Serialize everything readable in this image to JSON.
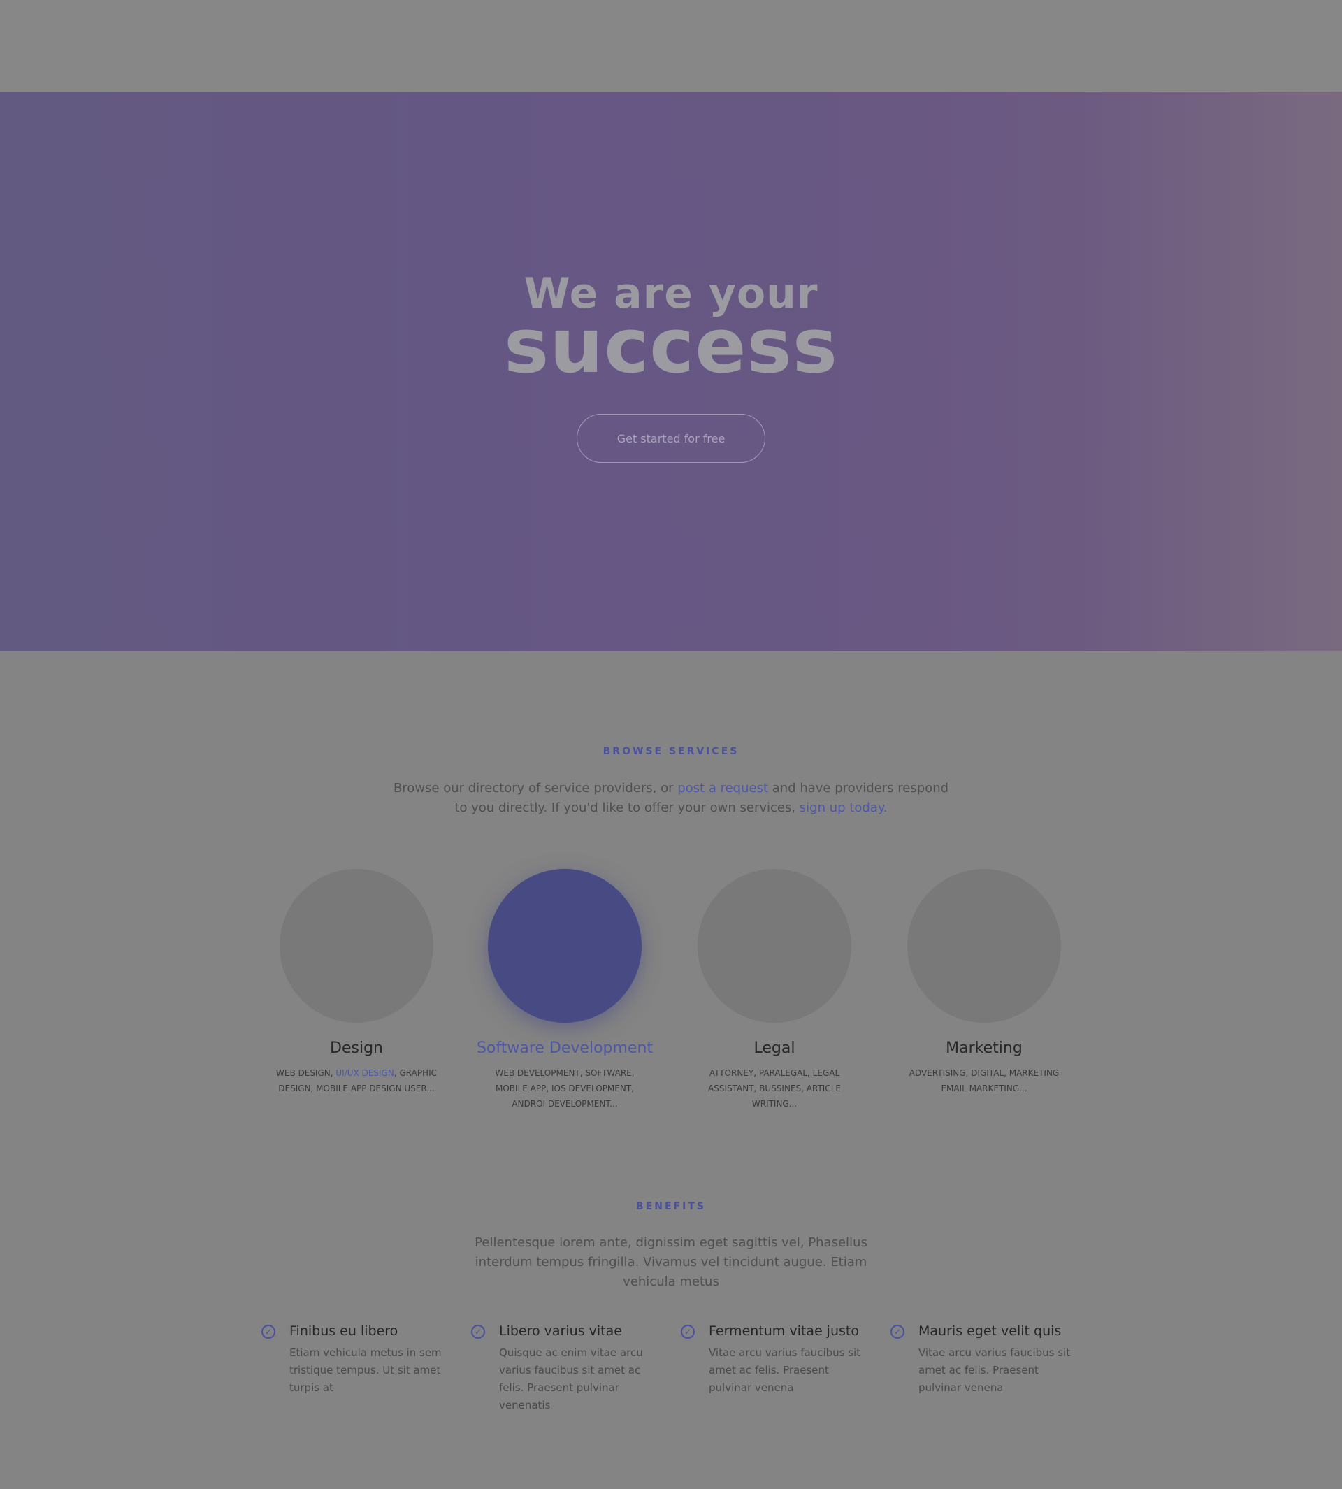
{
  "hero": {
    "line1": "We are your",
    "line2": "success",
    "cta_label": "Get started for free"
  },
  "browse": {
    "eyebrow": "BROWSE SERVICES",
    "text_before": "Browse our directory of service providers, or ",
    "link1": "post a request",
    "text_middle": " and have providers respond to you directly. If you'd like to offer your own services, ",
    "link2": "sign up today",
    "text_after": "."
  },
  "services": [
    {
      "title": "Design",
      "desc_before": "Web design, ",
      "desc_link": "UI/UX design",
      "desc_after": ", graphic design, mobile app design user..."
    },
    {
      "title": "Software Development",
      "desc": "Web development, software, mobile app, IOS development, androi development..."
    },
    {
      "title": "Legal",
      "desc": "Attorney, paralegal, legal assistant, bussines, article writing..."
    },
    {
      "title": "Marketing",
      "desc": "Advertising, digital, marketing email marketing..."
    }
  ],
  "benefits": {
    "eyebrow": "BENEFITS",
    "text": "Pellentesque lorem ante, dignissim eget sagittis vel, Phasellus interdum tempus fringilla. Vivamus vel tincidunt augue. Etiam vehicula metus",
    "items": [
      {
        "title": "Finibus eu libero",
        "text": "Etiam vehicula metus in sem tristique tempus. Ut sit amet turpis at"
      },
      {
        "title": "Libero varius vitae",
        "text": "Quisque ac enim vitae arcu varius faucibus sit amet ac felis. Praesent pulvinar venenatis"
      },
      {
        "title": "Fermentum vitae justo",
        "text": "Vitae arcu varius faucibus sit amet ac felis. Praesent pulvinar venena"
      },
      {
        "title": "Mauris eget velit quis",
        "text": "Vitae arcu varius faucibus sit amet ac felis. Praesent pulvinar venena"
      }
    ]
  }
}
